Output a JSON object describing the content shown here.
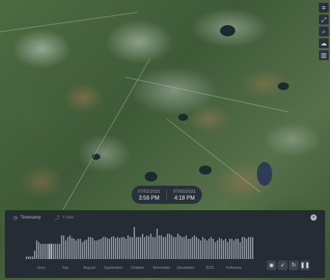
{
  "map": {
    "toolbar_icons": [
      "layers-icon",
      "expand-icon",
      "search-icon",
      "cloud-icon",
      "chart-icon"
    ]
  },
  "timestamps": {
    "start_date": "07/02/2021",
    "start_time": "3:56 PM",
    "end_date": "07/03/2021",
    "end_time": "4:18 PM"
  },
  "panel": {
    "tab_timestamp": "Timestamp",
    "tab_y_axis": "Y Axis",
    "close_icon": "close-icon",
    "controls": [
      "eye-icon",
      "rocket-icon",
      "refresh-icon",
      "pause-icon"
    ]
  },
  "chart_data": {
    "type": "bar",
    "x_ticks": [
      "June",
      "July",
      "August",
      "September",
      "October",
      "November",
      "December",
      "2022",
      "February"
    ],
    "selected_index": 11,
    "values": [
      3,
      3,
      3,
      3,
      10,
      22,
      20,
      18,
      18,
      18,
      18,
      18,
      18,
      18,
      18,
      18,
      18,
      28,
      28,
      22,
      26,
      28,
      25,
      24,
      22,
      24,
      24,
      20,
      22,
      23,
      26,
      26,
      25,
      22,
      22,
      23,
      24,
      26,
      26,
      25,
      24,
      26,
      27,
      25,
      26,
      25,
      26,
      26,
      24,
      28,
      26,
      26,
      38,
      26,
      26,
      26,
      30,
      26,
      28,
      27,
      30,
      26,
      26,
      36,
      28,
      28,
      26,
      26,
      30,
      30,
      28,
      26,
      26,
      30,
      28,
      26,
      26,
      28,
      24,
      24,
      26,
      28,
      26,
      24,
      22,
      26,
      24,
      22,
      24,
      26,
      24,
      20,
      22,
      25,
      24,
      22,
      24,
      20,
      24,
      24,
      22,
      24,
      24,
      20,
      26,
      26,
      24,
      26,
      26,
      26
    ]
  }
}
